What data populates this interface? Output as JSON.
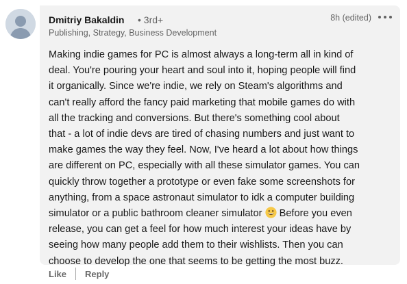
{
  "comment": {
    "author_name": "Dmitriy Bakaldin",
    "connection_degree": "• 3rd+",
    "headline": "Publishing, Strategy, Business Development",
    "timestamp": "8h (edited)",
    "body_part1": "Making indie games for PC is almost always a long-term all in kind of\ndeal. You're pouring your heart and soul into it, hoping people will find\nit organically. Since we're indie, we rely on Steam's algorithms and\ncan't really afford the fancy paid marketing that mobile games do with\nall the tracking and conversions. But there's something cool about\nthat - a lot of indie devs are tired of chasing numbers and just want to\nmake games the way they feel. Now, I've heard a lot about how things\nare different on PC, especially with all these simulator games. You can\nquickly throw together a prototype or even fake some screenshots for\nanything, from a space astronaut simulator to idk a computer building\nsimulator or a public bathroom cleaner simulator ",
    "body_part2": " Before you even\nrelease, you can get a feel for how much interest your ideas have by\nseeing how many people add them to their wishlists. Then you can\nchoose to develop the one that seems to be getting the most buzz.",
    "emoji": "grinning-face-emoji"
  },
  "actions": {
    "like_label": "Like",
    "reply_label": "Reply"
  },
  "colors": {
    "bubble_background": "#f2f2f2",
    "avatar_background": "#d0d9e3",
    "avatar_figure": "#8a9bb0",
    "emoji_face": "#f7c948"
  },
  "icons": {
    "more": "more-options-icon",
    "avatar": "default-avatar-icon"
  }
}
